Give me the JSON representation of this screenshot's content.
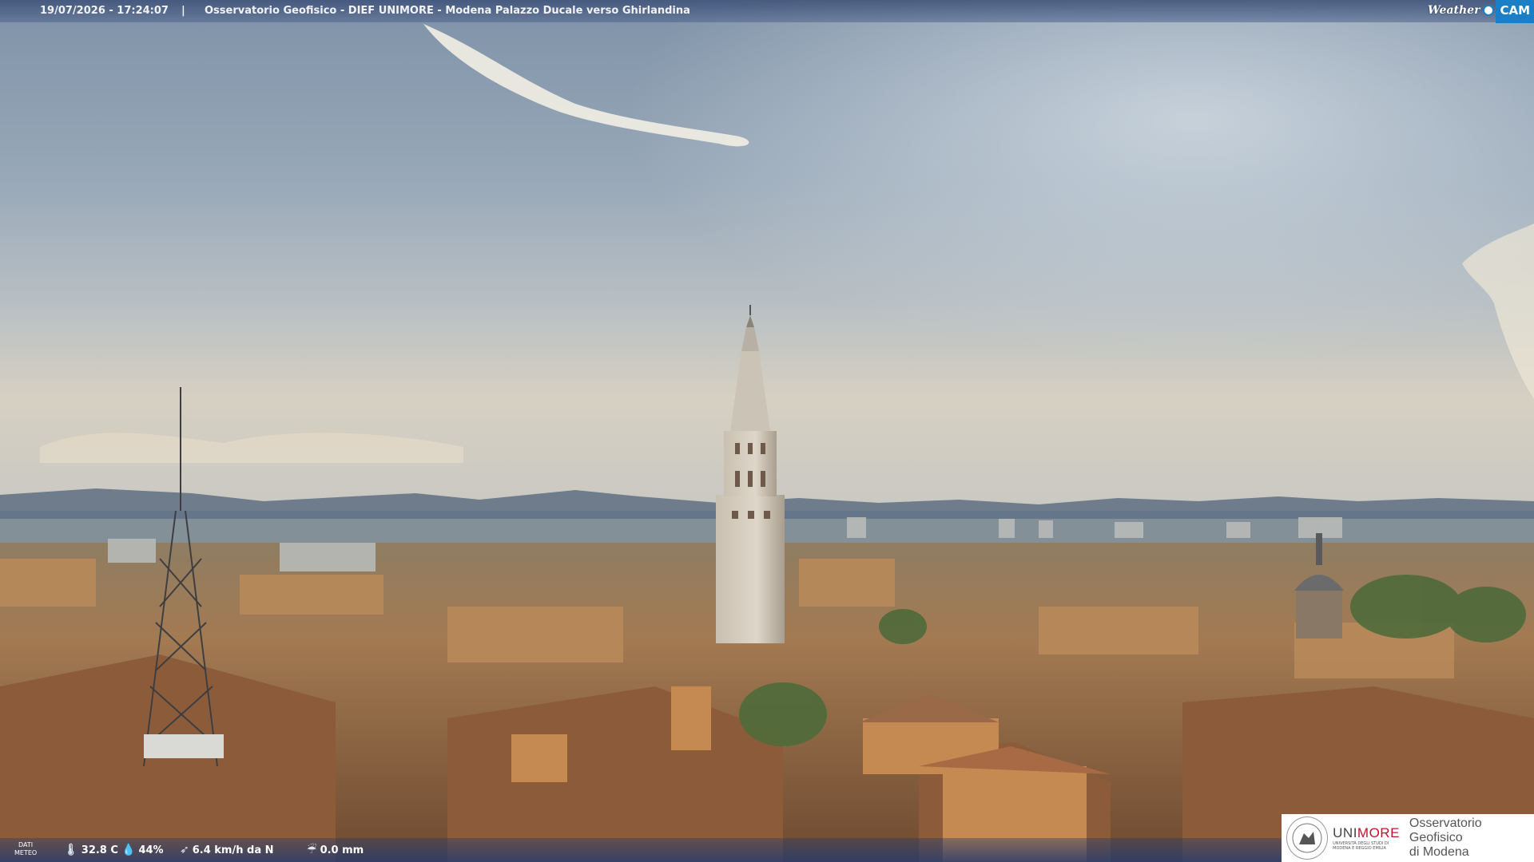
{
  "header": {
    "timestamp": "19/07/2026 - 17:24:07",
    "separator": "|",
    "title": "Osservatorio Geofisico - DIEF UNIMORE - Modena Palazzo Ducale verso Ghirlandina",
    "brand_weather": "Weather",
    "brand_cam": "CAM"
  },
  "weather": {
    "label_line1": "DATI",
    "label_line2": "METEO",
    "temperature": "32.8 C",
    "humidity": "44%",
    "wind": "6.4 km/h da N",
    "rain": "0.0 mm",
    "icons": [
      "thermometer-icon",
      "humidity-drop-icon",
      "wind-sock-icon",
      "rain-gauge-icon"
    ]
  },
  "logo": {
    "uni_prefix": "UNI",
    "uni_suffix": "MORE",
    "uni_small_1": "UNIVERSITÀ DEGLI STUDI DI",
    "uni_small_2": "MODENA E REGGIO EMILIA",
    "obs_line1": "Osservatorio Geofisico",
    "obs_line2": "di Modena",
    "accent": "#c8102e"
  },
  "colors": {
    "sky_top": "#8296ad",
    "sky_horizon": "#d9d3c4",
    "roofs": "#9a6a45",
    "cam_blue": "#1a7fc4"
  }
}
